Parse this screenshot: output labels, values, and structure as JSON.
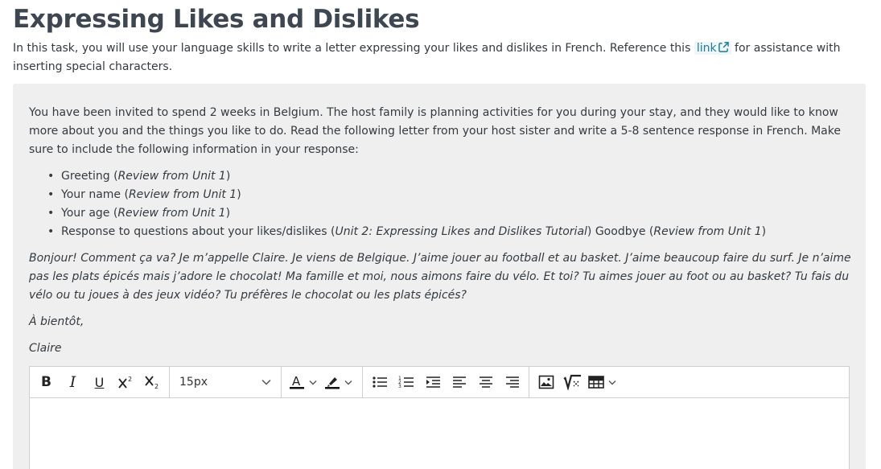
{
  "title": "Expressing Likes and Dislikes",
  "intro": {
    "before_link": "In this task, you will use your language skills to write a letter expressing your likes and dislikes in French. Reference this",
    "link_label": "link",
    "after_link": "for assistance with inserting special characters."
  },
  "prompt": {
    "instructions": "You have been invited to spend 2 weeks in Belgium. The host family is planning activities for you during your stay, and they would like to know more about you and the things you like to do. Read the following letter from your host sister and write a 5-8 sentence response in French. Make sure to include the following information in your response:",
    "items": [
      {
        "text": "Greeting (",
        "ref": "Review from Unit 1",
        "close": ")"
      },
      {
        "text": "Your name (",
        "ref": "Review from Unit 1",
        "close": ")"
      },
      {
        "text": "Your age (",
        "ref": "Review from Unit 1",
        "close": ")"
      },
      {
        "text": "Response to questions about your likes/dislikes (",
        "ref": "Unit 2: Expressing Likes and Dislikes Tutorial",
        "mid": ") Goodbye (",
        "ref2": "Review from Unit 1",
        "close": ")"
      }
    ],
    "letter": "Bonjour! Comment ça va? Je m’appelle Claire. Je viens de Belgique. J’aime jouer au football et au basket. J’aime beaucoup faire du surf. Je n’aime pas les plats épicés mais j’adore le chocolat! Ma famille et moi, nous aimons faire du vélo. Et toi? Tu aimes jouer au foot ou au basket? Tu fais du vélo ou tu joues à des jeux vidéo? Tu préfères le chocolat ou les plats épicés?",
    "signoff": "À bientôt,",
    "signature": "Claire"
  },
  "editor": {
    "font_size": "15px",
    "buttons": {
      "bold": "B",
      "italic": "I",
      "underline": "U"
    },
    "text_color_letter": "A"
  }
}
